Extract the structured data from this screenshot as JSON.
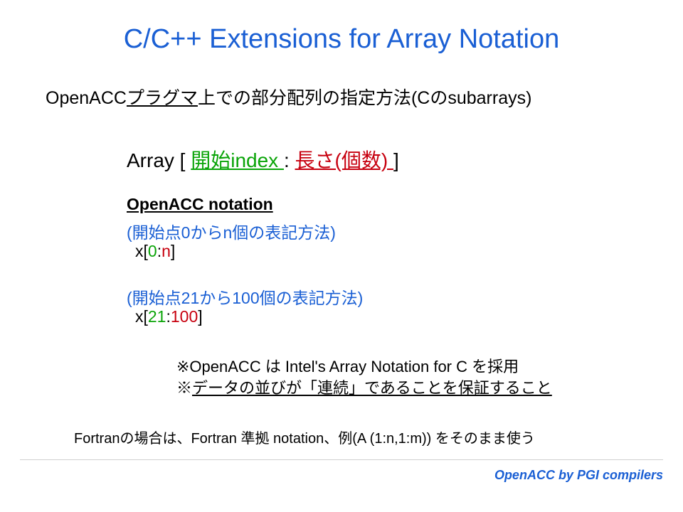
{
  "title": "C/C++ Extensions for Array Notation",
  "subtitle_pre": "OpenACC",
  "subtitle_u": "プラグマ",
  "subtitle_post": "上での部分配列の指定方法(Cのsubarrays)",
  "syntax_arr": "Array [ ",
  "syntax_start": "開始index ",
  "syntax_colon": " : ",
  "syntax_len": "長さ(個数) ",
  "syntax_close": " ]",
  "notation_head": "OpenACC notation ",
  "desc1": "(開始点0からn個の表記方法)",
  "code1_x": "x[",
  "code1_a": "0",
  "code1_c": ":",
  "code1_b": "n",
  "code1_e": "]",
  "desc2": "(開始点21から100個の表記方法)",
  "code2_x": "x[",
  "code2_a": "21",
  "code2_c": ":",
  "code2_b": "100",
  "code2_e": "]",
  "note1": "※OpenACC は Intel's Array Notation for C  を採用",
  "note2_pre": "※",
  "note2_u": "データの並びが「連続」であることを保証すること",
  "fortran": "Fortranの場合は、Fortran 準拠 notation、例(A (1:n,1:m)) をそのまま使う",
  "footer": "OpenACC by PGI compilers"
}
